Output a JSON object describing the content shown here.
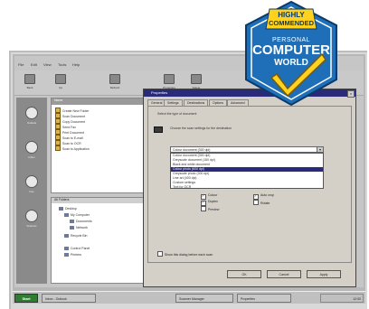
{
  "badge": {
    "line1": "HIGHLY",
    "line2": "COMMENDED",
    "line3": "PERSONAL",
    "line4": "COMPUTER",
    "line5": "WORLD"
  },
  "colors": {
    "badge_blue": "#1f6fb8",
    "badge_yellow": "#ffd21f",
    "dialog_title": "#2a2a7a",
    "start_button": "#2e7d32"
  },
  "window": {
    "menu": [
      "File",
      "Edit",
      "View",
      "Tools",
      "Help"
    ],
    "toolbar": [
      {
        "label": "Back",
        "icon": "back-icon"
      },
      {
        "label": "Up",
        "icon": "up-folder-icon"
      },
      {
        "label": "Refresh",
        "icon": "refresh-icon"
      },
      {
        "label": "Properties",
        "icon": "properties-icon"
      },
      {
        "label": "Delete",
        "icon": "delete-icon"
      }
    ],
    "leftbar": [
      {
        "label": "Outlook",
        "icon": "outlook-icon"
      },
      {
        "label": "Inbox",
        "icon": "inbox-icon"
      },
      {
        "label": "Fax",
        "icon": "fax-icon"
      },
      {
        "label": "Scanner",
        "icon": "scanner-icon"
      }
    ],
    "list_header": "Name",
    "list_items": [
      "Create New Folder",
      "Scan Document",
      "Copy Document",
      "Send Fax",
      "Print Document",
      "Scan to E-mail",
      "Scan to OCR",
      "Scan to Application"
    ],
    "tree_header": "All Folders",
    "tree_items": [
      "Desktop",
      "My Computer",
      "Documents",
      "Network",
      "Recycle Bin",
      "Control Panel",
      "Printers"
    ]
  },
  "dialog": {
    "title": "Properties",
    "close": "×",
    "tabs": [
      "General",
      "Settings",
      "Destinations",
      "Options",
      "Advanced"
    ],
    "label_top": "Select the type of document",
    "label_sub": "Choose the scan settings for the destination",
    "combo_value": "Colour document (300 dpi)",
    "options": [
      "Colour document (300 dpi)",
      "Greyscale document (150 dpi)",
      "Black and white document",
      "Colour photo (600 dpi)",
      "Greyscale photo (300 dpi)",
      "Line art (400 dpi)",
      "Custom settings",
      "Text for OCR"
    ],
    "selected_index": 3,
    "checks_left": [
      {
        "label": "Colour",
        "checked": true
      },
      {
        "label": "Duplex",
        "checked": true
      },
      {
        "label": "Preview",
        "checked": false
      }
    ],
    "checks_right": [
      {
        "label": "Auto crop",
        "checked": true
      },
      {
        "label": "Rotate",
        "checked": false
      }
    ],
    "bottom_check": "Show this dialog before each scan",
    "buttons": [
      "OK",
      "Cancel",
      "Apply"
    ]
  },
  "taskbar": {
    "start": "Start",
    "tasks": [
      "Inbox - Outlook",
      "Scanner Manager",
      "Properties"
    ],
    "tray": "12:00"
  }
}
